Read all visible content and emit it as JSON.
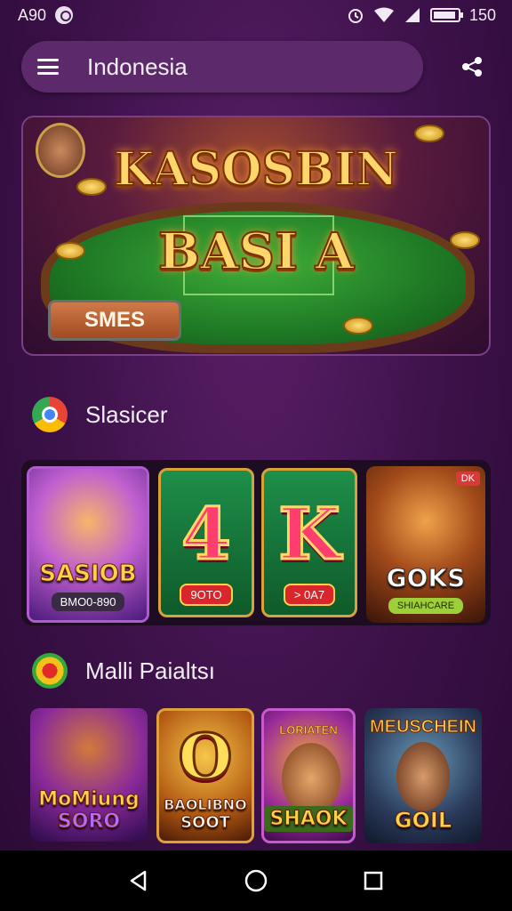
{
  "status_bar": {
    "time": "A90",
    "battery_text": "150"
  },
  "search": {
    "value": "Indonesia"
  },
  "banner": {
    "title_line1": "KASOSBIN",
    "title_line2": "BASI A",
    "button_label": "SMES"
  },
  "sections": [
    {
      "title": "Slasicer",
      "logo": "chrome-logo",
      "cards": [
        {
          "title": "SASIOB",
          "subtitle": "BMO0-890",
          "icon": "lion-icon"
        },
        {
          "glyph": "4",
          "subtitle": "9OTO",
          "icon": "four-card-icon"
        },
        {
          "glyph": "K",
          "subtitle": "> 0A7",
          "icon": "king-card-icon"
        },
        {
          "title": "GOKS",
          "subtitle": "SHIAHCARE",
          "badge": "DK",
          "icon": "cougar-icon"
        }
      ]
    },
    {
      "title": "Malli Paialtsı",
      "logo": "target-logo",
      "cards": [
        {
          "title": "MoMiung",
          "title2": "SORO",
          "icon": "cowboy-icon"
        },
        {
          "glyph": "O",
          "title": "BAOLIBNO",
          "title2": "SOOT",
          "icon": "gold-o-icon"
        },
        {
          "top": "LORIATEN",
          "title": "SHAOK",
          "icon": "miner-icon"
        },
        {
          "top": "MEUSCHEIN",
          "title": "GOIL",
          "icon": "engineer-icon"
        }
      ]
    }
  ],
  "nav": {
    "back_icon": "back-triangle-icon",
    "home_icon": "home-circle-icon",
    "recents_icon": "recents-square-icon"
  }
}
